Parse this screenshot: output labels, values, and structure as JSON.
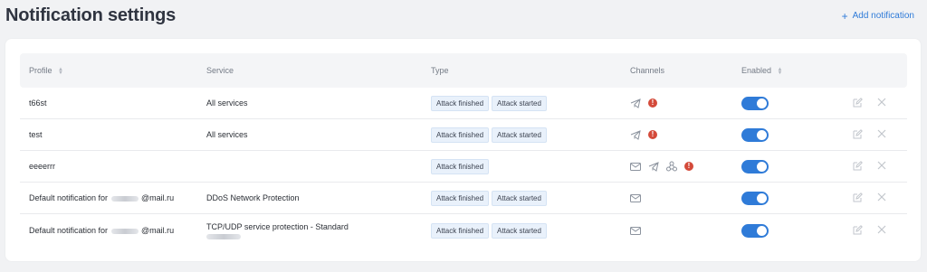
{
  "header": {
    "title": "Notification settings",
    "add_label": "Add notification",
    "add_icon": "plus-icon"
  },
  "table": {
    "columns": {
      "profile": "Profile",
      "service": "Service",
      "type": "Type",
      "channels": "Channels",
      "enabled": "Enabled"
    },
    "rows": [
      {
        "profile": "t66st",
        "service": "All services",
        "types": [
          "Attack finished",
          "Attack started"
        ],
        "channels": [
          "telegram-icon",
          "warning-icon"
        ],
        "enabled": true
      },
      {
        "profile": "test",
        "service": "All services",
        "types": [
          "Attack finished",
          "Attack started"
        ],
        "channels": [
          "telegram-icon",
          "warning-icon"
        ],
        "enabled": true
      },
      {
        "profile": "eeeerrr",
        "service": "",
        "types": [
          "Attack finished"
        ],
        "channels": [
          "email-icon",
          "telegram-icon",
          "webhook-icon",
          "warning-icon"
        ],
        "enabled": true
      },
      {
        "profile_prefix": "Default notification for",
        "profile_suffix": "@mail.ru",
        "service": "DDoS Network Protection",
        "types": [
          "Attack finished",
          "Attack started"
        ],
        "channels": [
          "email-icon"
        ],
        "enabled": true
      },
      {
        "profile_prefix": "Default notification for",
        "profile_suffix": "@mail.ru",
        "service": "TCP/UDP service protection - Standard",
        "types": [
          "Attack finished",
          "Attack started"
        ],
        "channels": [
          "email-icon"
        ],
        "enabled": true
      }
    ]
  },
  "colors": {
    "accent": "#2f7bd8",
    "warning": "#d44a3a",
    "tag_bg": "#e9f1fb"
  },
  "warning_glyph": "!"
}
